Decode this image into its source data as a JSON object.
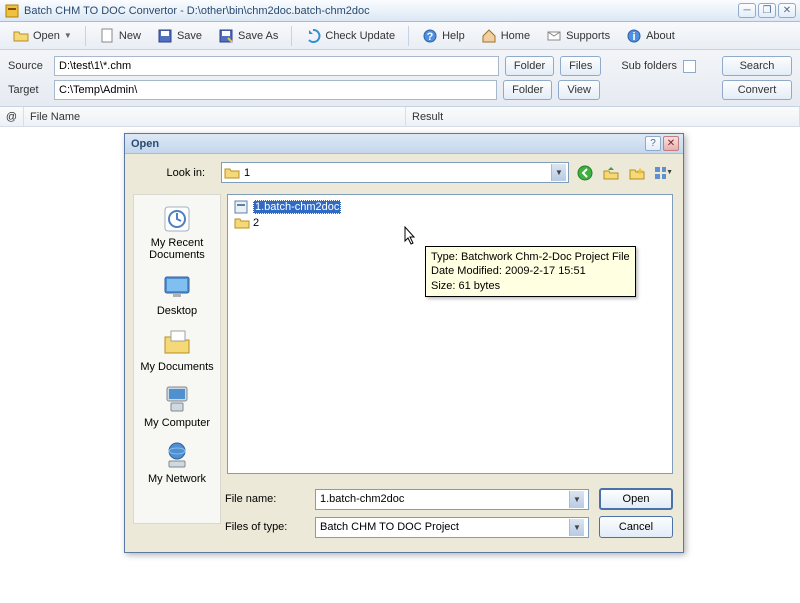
{
  "window": {
    "title": "Batch CHM TO DOC Convertor - D:\\other\\bin\\chm2doc.batch-chm2doc"
  },
  "toolbar": {
    "open": "Open",
    "new": "New",
    "save": "Save",
    "saveas": "Save As",
    "check": "Check Update",
    "help": "Help",
    "home": "Home",
    "supports": "Supports",
    "about": "About"
  },
  "io": {
    "source_label": "Source",
    "source_value": "D:\\test\\1\\*.chm",
    "target_label": "Target",
    "target_value": "C:\\Temp\\Admin\\",
    "folder_btn": "Folder",
    "files_btn": "Files",
    "view_btn": "View",
    "subfolders_label": "Sub folders",
    "search_btn": "Search",
    "convert_btn": "Convert"
  },
  "list": {
    "at": "@",
    "filename": "File Name",
    "result": "Result"
  },
  "dialog": {
    "title": "Open",
    "lookin_label": "Look in:",
    "lookin_value": "1",
    "places": {
      "recent": "My Recent Documents",
      "desktop": "Desktop",
      "mydocs": "My Documents",
      "mycomp": "My Computer",
      "mynet": "My Network"
    },
    "files": {
      "f1": "1.batch-chm2doc",
      "f2": "2"
    },
    "tooltip": {
      "l1": "Type: Batchwork Chm-2-Doc Project File",
      "l2": "Date Modified: 2009-2-17 15:51",
      "l3": "Size: 61 bytes"
    },
    "filename_label": "File name:",
    "filename_value": "1.batch-chm2doc",
    "filetype_label": "Files of type:",
    "filetype_value": "Batch CHM TO DOC Project",
    "open_btn": "Open",
    "cancel_btn": "Cancel"
  }
}
